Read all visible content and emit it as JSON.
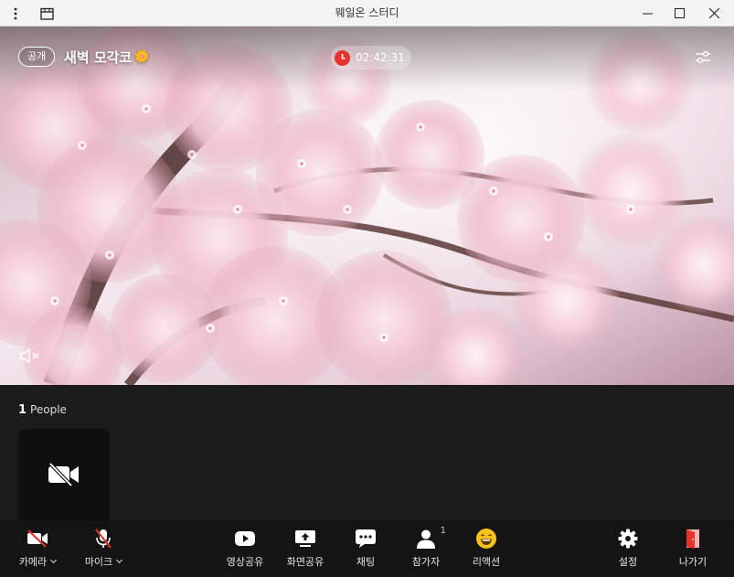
{
  "window": {
    "title": "웨일온 스터디",
    "menu_icon": "more-vertical-icon",
    "calendar_icon": "calendar-icon"
  },
  "room": {
    "visibility_badge": "공개",
    "title": "새벽 모각코",
    "title_emoji": "🌼",
    "timer": "02:42:31"
  },
  "people": {
    "count": "1",
    "label": "People"
  },
  "toolbar": {
    "camera": "카메라",
    "mic": "마이크",
    "share_video": "영상공유",
    "share_screen": "화면공유",
    "chat": "채팅",
    "participants": "참가자",
    "participants_count": "1",
    "reactions": "리액션",
    "settings": "설정",
    "leave": "나가기"
  },
  "colors": {
    "accent_red": "#e5322d",
    "toolbar_bg": "#141414",
    "panel_bg": "#1b1b1b",
    "tile_bg": "#0f0f0f"
  }
}
